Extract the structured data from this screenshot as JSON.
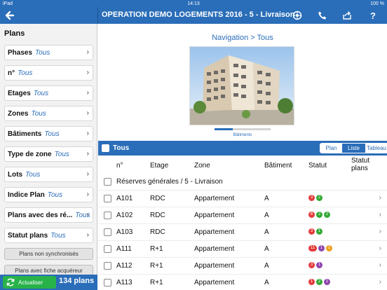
{
  "status": {
    "device": "iPad",
    "time": "14:13",
    "battery": "100 %"
  },
  "navbar": {
    "title": "OPERATION DEMO LOGEMENTS 2016 - 5 - Livraison"
  },
  "sidebar": {
    "title": "Plans",
    "filters": [
      {
        "label": "Phases",
        "value": "Tous"
      },
      {
        "label": "n°",
        "value": "Tous"
      },
      {
        "label": "Etages",
        "value": "Tous"
      },
      {
        "label": "Zones",
        "value": "Tous"
      },
      {
        "label": "Bâtiments",
        "value": "Tous"
      },
      {
        "label": "Type de zone",
        "value": "Tous"
      },
      {
        "label": "Lots",
        "value": "Tous"
      },
      {
        "label": "Indice Plan",
        "value": "Tous"
      },
      {
        "label": "Plans avec des ré...",
        "value": "Tous"
      },
      {
        "label": "Statut plans",
        "value": "Tous"
      }
    ],
    "buttons": [
      "Plans non synchronisés",
      "Plans avec fiche acquéreur"
    ],
    "actualiser": "Actualiser",
    "count": "134 plans"
  },
  "main": {
    "breadcrumb": "Navigation  >  Tous",
    "pager_label": "Bâtiments",
    "pager_progress": 0.33,
    "select_all": "Tous",
    "views": [
      "Plan",
      "Liste",
      "Tableau"
    ],
    "active_view": "Liste",
    "columns": [
      "n°",
      "Etage",
      "Zone",
      "Bâtiment",
      "Statut",
      "Statut plans"
    ],
    "group_row": "Réserves générales / 5 - Livraison",
    "rows": [
      {
        "num": "A101",
        "etage": "RDC",
        "zone": "Appartement",
        "batiment": "A",
        "statuts": [
          {
            "n": "3",
            "color": "#e23b3b"
          },
          {
            "n": "2",
            "color": "#33a833"
          }
        ]
      },
      {
        "num": "A102",
        "etage": "RDC",
        "zone": "Appartement",
        "batiment": "A",
        "statuts": [
          {
            "n": "6",
            "color": "#e23b3b"
          },
          {
            "n": "2",
            "color": "#33a833"
          },
          {
            "n": "2",
            "color": "#33a833"
          }
        ]
      },
      {
        "num": "A103",
        "etage": "RDC",
        "zone": "Appartement",
        "batiment": "A",
        "statuts": [
          {
            "n": "3",
            "color": "#e23b3b"
          },
          {
            "n": "1",
            "color": "#33a833"
          }
        ]
      },
      {
        "num": "A111",
        "etage": "R+1",
        "zone": "Appartement",
        "batiment": "A",
        "statuts": [
          {
            "n": "11",
            "color": "#e23b3b"
          },
          {
            "n": "1",
            "color": "#8e44ad"
          },
          {
            "n": "1",
            "color": "#f0a020"
          }
        ]
      },
      {
        "num": "A112",
        "etage": "R+1",
        "zone": "Appartement",
        "batiment": "A",
        "statuts": [
          {
            "n": "3",
            "color": "#e23b3b"
          },
          {
            "n": "1",
            "color": "#8e44ad"
          }
        ]
      },
      {
        "num": "A113",
        "etage": "R+1",
        "zone": "Appartement",
        "batiment": "A",
        "statuts": [
          {
            "n": "1",
            "color": "#e23b3b"
          },
          {
            "n": "2",
            "color": "#33a833"
          },
          {
            "n": "1",
            "color": "#8e44ad"
          }
        ]
      }
    ]
  },
  "colors": {
    "primary": "#2a6db8",
    "green": "#28b24a"
  }
}
